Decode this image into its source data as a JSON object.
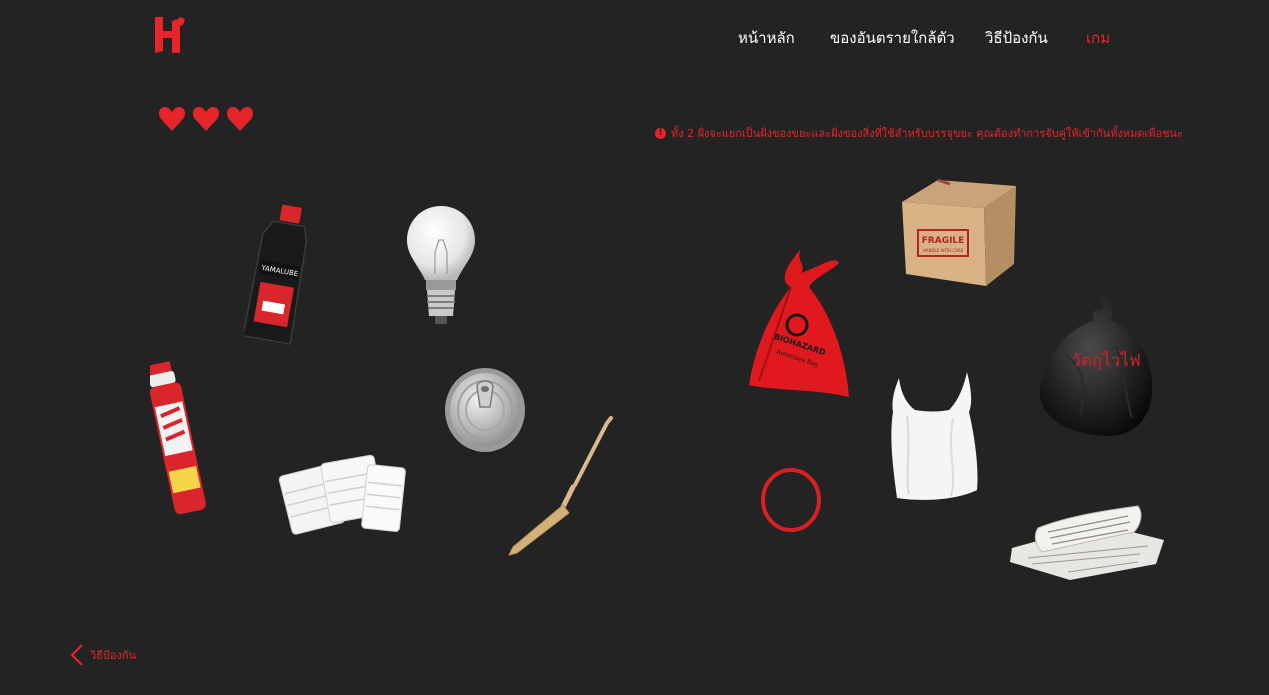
{
  "nav": {
    "items": [
      {
        "label": "หน้าหลัก",
        "active": false
      },
      {
        "label": "ของอันตรายใกล้ตัว",
        "active": false
      },
      {
        "label": "วิธีป้องกัน",
        "active": false
      },
      {
        "label": "เกม",
        "active": true
      }
    ]
  },
  "game": {
    "lives": 3,
    "instruction": "ทั้ง 2 ฝั่งจะแยกเป็นฝั่งของขยะและฝั่งของสิ่งที่ใช้สำหรับบรรจุขยะ คุณต้องทำการจับคู่ให้เข้ากันทั้งหมดเพื่อชนะ",
    "waste_items": [
      {
        "icon": "engine-oil-bottle-icon",
        "brand_text": "YAMALUBE"
      },
      {
        "icon": "light-bulb-icon"
      },
      {
        "icon": "spray-can-icon"
      },
      {
        "icon": "tin-can-lid-icon"
      },
      {
        "icon": "face-masks-icon"
      },
      {
        "icon": "bamboo-skewer-icon"
      }
    ],
    "containers": [
      {
        "icon": "cardboard-box-icon",
        "label": "FRAGILE",
        "sublabel": "HANDLE WITH CARE"
      },
      {
        "icon": "biohazard-bag-icon",
        "label": "BIOHAZARD",
        "sublabel": "Autoclave Bag"
      },
      {
        "icon": "black-garbage-bag-icon",
        "label": "วัตถุไวไฟ"
      },
      {
        "icon": "white-plastic-bag-icon"
      },
      {
        "icon": "rubber-band-icon"
      },
      {
        "icon": "newspaper-icon"
      }
    ]
  },
  "footer": {
    "back_label": "วิธีป้องกัน"
  },
  "colors": {
    "background": "#232323",
    "accent": "#e5252a",
    "text": "#ffffff"
  }
}
